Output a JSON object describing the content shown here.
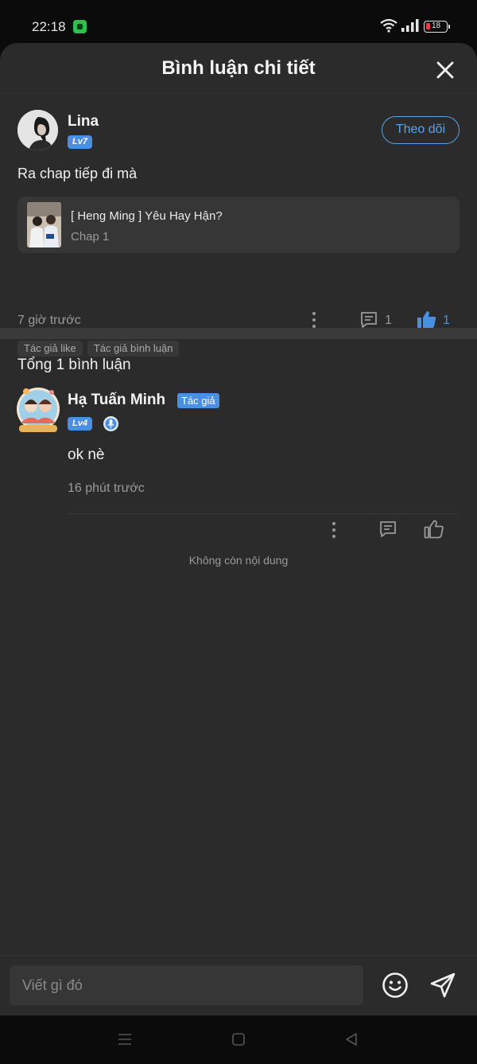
{
  "status_bar": {
    "time": "22:18",
    "battery": "18"
  },
  "header": {
    "title": "Bình luận chi tiết"
  },
  "post": {
    "author": "Lina",
    "level": "Lv7",
    "follow_label": "Theo dõi",
    "content": "Ra chap tiếp đi mà",
    "chapter_card": {
      "title": "[ Heng Ming ] Yêu Hay Hận?",
      "subtitle": "Chap 1"
    },
    "time": "7 giờ trước",
    "reply_count": "1",
    "like_count": "1",
    "tags": [
      "Tác giả like",
      "Tác giả bình luận"
    ]
  },
  "comments_header": "Tổng 1 bình luận",
  "comments": [
    {
      "author": "Hạ Tuấn Minh",
      "badge": "Tác giả",
      "level": "Lv4",
      "text": "ok nè",
      "time": "16 phút trước"
    }
  ],
  "end_text": "Không còn nội dung",
  "input": {
    "placeholder": "Viết gì đó"
  },
  "colors": {
    "accent": "#4a90e2",
    "background": "#2b2b2b",
    "like_active": "#4a90e2"
  }
}
